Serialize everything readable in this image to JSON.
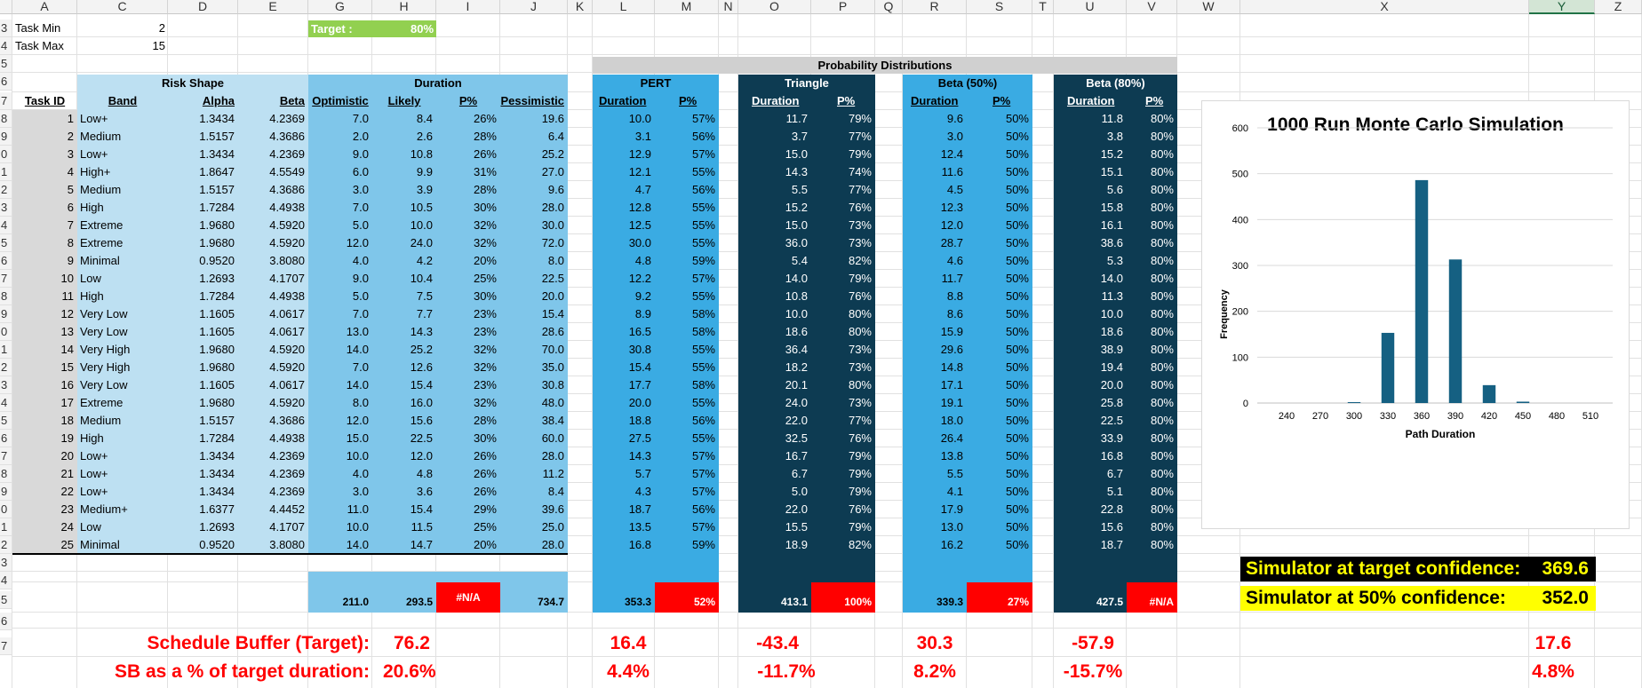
{
  "columns": [
    "A",
    "C",
    "D",
    "E",
    "G",
    "H",
    "I",
    "J",
    "K",
    "L",
    "M",
    "N",
    "O",
    "P",
    "Q",
    "R",
    "S",
    "T",
    "U",
    "V",
    "W",
    "X",
    "Y",
    "Z"
  ],
  "row_numbers": [
    "3",
    "4",
    "5",
    "6",
    "7",
    "8",
    "9",
    "0",
    "1",
    "2",
    "3",
    "4",
    "5",
    "6",
    "7",
    "8",
    "9",
    "0",
    "1",
    "2",
    "3",
    "4",
    "5",
    "6",
    "7",
    "8",
    "9",
    "0",
    "1",
    "2",
    "3",
    "4",
    "5",
    "6",
    "7"
  ],
  "params": {
    "task_min_label": "Task Min",
    "task_min": "2",
    "task_max_label": "Task Max",
    "task_max": "15",
    "target_label": "Target :",
    "target_value": "80%"
  },
  "headers": {
    "prob_dist": "Probability Distributions",
    "risk_shape": "Risk Shape",
    "duration": "Duration",
    "pert": "PERT",
    "triangle": "Triangle",
    "beta50": "Beta (50%)",
    "beta80": "Beta (80%)",
    "task_id": "Task ID",
    "band": "Band",
    "alpha": "Alpha",
    "beta": "Beta",
    "optimistic": "Optimistic",
    "likely": "Likely",
    "ppct": "P%",
    "pessimistic": "Pessimistic",
    "dur": "Duration"
  },
  "rows": [
    [
      "1",
      "Low+",
      "1.3434",
      "4.2369",
      "7.0",
      "8.4",
      "26%",
      "19.6",
      "10.0",
      "57%",
      "11.7",
      "79%",
      "9.6",
      "50%",
      "11.8",
      "80%"
    ],
    [
      "2",
      "Medium",
      "1.5157",
      "4.3686",
      "2.0",
      "2.6",
      "28%",
      "6.4",
      "3.1",
      "56%",
      "3.7",
      "77%",
      "3.0",
      "50%",
      "3.8",
      "80%"
    ],
    [
      "3",
      "Low+",
      "1.3434",
      "4.2369",
      "9.0",
      "10.8",
      "26%",
      "25.2",
      "12.9",
      "57%",
      "15.0",
      "79%",
      "12.4",
      "50%",
      "15.2",
      "80%"
    ],
    [
      "4",
      "High+",
      "1.8647",
      "4.5549",
      "6.0",
      "9.9",
      "31%",
      "27.0",
      "12.1",
      "55%",
      "14.3",
      "74%",
      "11.6",
      "50%",
      "15.1",
      "80%"
    ],
    [
      "5",
      "Medium",
      "1.5157",
      "4.3686",
      "3.0",
      "3.9",
      "28%",
      "9.6",
      "4.7",
      "56%",
      "5.5",
      "77%",
      "4.5",
      "50%",
      "5.6",
      "80%"
    ],
    [
      "6",
      "High",
      "1.7284",
      "4.4938",
      "7.0",
      "10.5",
      "30%",
      "28.0",
      "12.8",
      "55%",
      "15.2",
      "76%",
      "12.3",
      "50%",
      "15.8",
      "80%"
    ],
    [
      "7",
      "Extreme",
      "1.9680",
      "4.5920",
      "5.0",
      "10.0",
      "32%",
      "30.0",
      "12.5",
      "55%",
      "15.0",
      "73%",
      "12.0",
      "50%",
      "16.1",
      "80%"
    ],
    [
      "8",
      "Extreme",
      "1.9680",
      "4.5920",
      "12.0",
      "24.0",
      "32%",
      "72.0",
      "30.0",
      "55%",
      "36.0",
      "73%",
      "28.7",
      "50%",
      "38.6",
      "80%"
    ],
    [
      "9",
      "Minimal",
      "0.9520",
      "3.8080",
      "4.0",
      "4.2",
      "20%",
      "8.0",
      "4.8",
      "59%",
      "5.4",
      "82%",
      "4.6",
      "50%",
      "5.3",
      "80%"
    ],
    [
      "10",
      "Low",
      "1.2693",
      "4.1707",
      "9.0",
      "10.4",
      "25%",
      "22.5",
      "12.2",
      "57%",
      "14.0",
      "79%",
      "11.7",
      "50%",
      "14.0",
      "80%"
    ],
    [
      "11",
      "High",
      "1.7284",
      "4.4938",
      "5.0",
      "7.5",
      "30%",
      "20.0",
      "9.2",
      "55%",
      "10.8",
      "76%",
      "8.8",
      "50%",
      "11.3",
      "80%"
    ],
    [
      "12",
      "Very Low",
      "1.1605",
      "4.0617",
      "7.0",
      "7.7",
      "23%",
      "15.4",
      "8.9",
      "58%",
      "10.0",
      "80%",
      "8.6",
      "50%",
      "10.0",
      "80%"
    ],
    [
      "13",
      "Very Low",
      "1.1605",
      "4.0617",
      "13.0",
      "14.3",
      "23%",
      "28.6",
      "16.5",
      "58%",
      "18.6",
      "80%",
      "15.9",
      "50%",
      "18.6",
      "80%"
    ],
    [
      "14",
      "Very High",
      "1.9680",
      "4.5920",
      "14.0",
      "25.2",
      "32%",
      "70.0",
      "30.8",
      "55%",
      "36.4",
      "73%",
      "29.6",
      "50%",
      "38.9",
      "80%"
    ],
    [
      "15",
      "Very High",
      "1.9680",
      "4.5920",
      "7.0",
      "12.6",
      "32%",
      "35.0",
      "15.4",
      "55%",
      "18.2",
      "73%",
      "14.8",
      "50%",
      "19.4",
      "80%"
    ],
    [
      "16",
      "Very Low",
      "1.1605",
      "4.0617",
      "14.0",
      "15.4",
      "23%",
      "30.8",
      "17.7",
      "58%",
      "20.1",
      "80%",
      "17.1",
      "50%",
      "20.0",
      "80%"
    ],
    [
      "17",
      "Extreme",
      "1.9680",
      "4.5920",
      "8.0",
      "16.0",
      "32%",
      "48.0",
      "20.0",
      "55%",
      "24.0",
      "73%",
      "19.1",
      "50%",
      "25.8",
      "80%"
    ],
    [
      "18",
      "Medium",
      "1.5157",
      "4.3686",
      "12.0",
      "15.6",
      "28%",
      "38.4",
      "18.8",
      "56%",
      "22.0",
      "77%",
      "18.0",
      "50%",
      "22.5",
      "80%"
    ],
    [
      "19",
      "High",
      "1.7284",
      "4.4938",
      "15.0",
      "22.5",
      "30%",
      "60.0",
      "27.5",
      "55%",
      "32.5",
      "76%",
      "26.4",
      "50%",
      "33.9",
      "80%"
    ],
    [
      "20",
      "Low+",
      "1.3434",
      "4.2369",
      "10.0",
      "12.0",
      "26%",
      "28.0",
      "14.3",
      "57%",
      "16.7",
      "79%",
      "13.8",
      "50%",
      "16.8",
      "80%"
    ],
    [
      "21",
      "Low+",
      "1.3434",
      "4.2369",
      "4.0",
      "4.8",
      "26%",
      "11.2",
      "5.7",
      "57%",
      "6.7",
      "79%",
      "5.5",
      "50%",
      "6.7",
      "80%"
    ],
    [
      "22",
      "Low+",
      "1.3434",
      "4.2369",
      "3.0",
      "3.6",
      "26%",
      "8.4",
      "4.3",
      "57%",
      "5.0",
      "79%",
      "4.1",
      "50%",
      "5.1",
      "80%"
    ],
    [
      "23",
      "Medium+",
      "1.6377",
      "4.4452",
      "11.0",
      "15.4",
      "29%",
      "39.6",
      "18.7",
      "56%",
      "22.0",
      "76%",
      "17.9",
      "50%",
      "22.8",
      "80%"
    ],
    [
      "24",
      "Low",
      "1.2693",
      "4.1707",
      "10.0",
      "11.5",
      "25%",
      "25.0",
      "13.5",
      "57%",
      "15.5",
      "79%",
      "13.0",
      "50%",
      "15.6",
      "80%"
    ],
    [
      "25",
      "Minimal",
      "0.9520",
      "3.8080",
      "14.0",
      "14.7",
      "20%",
      "28.0",
      "16.8",
      "59%",
      "18.9",
      "82%",
      "16.2",
      "50%",
      "18.7",
      "80%"
    ]
  ],
  "totals": {
    "opt": "211.0",
    "likely": "293.5",
    "ppct": "#N/A",
    "pess": "734.7",
    "pert": "353.3",
    "pert_p": "52%",
    "tri": "413.1",
    "tri_p": "100%",
    "b50": "339.3",
    "b50_p": "27%",
    "b80": "427.5",
    "b80_p": "#N/A"
  },
  "buffer": {
    "label1": "Schedule Buffer (Target):",
    "label2": "SB as a % of target duration:",
    "h1": "76.2",
    "h2": "20.6%",
    "l1": "16.4",
    "l2": "4.4%",
    "o1": "-43.4",
    "o2": "-11.7%",
    "r1": "30.3",
    "r2": "8.2%",
    "u1": "-57.9",
    "u2": "-15.7%",
    "y1": "17.6",
    "y2": "4.8%"
  },
  "sim": {
    "target_label": "Simulator at target confidence:",
    "target_value": "369.6",
    "half_label": "Simulator at 50% confidence:",
    "half_value": "352.0"
  },
  "colors": {
    "light": "#bde0f2",
    "mid": "#7fc6ea",
    "pert": "#3aabe3",
    "dark": "#0d3b52",
    "red": "#ff0000",
    "green": "#92d050",
    "grey": "#d0d0d0",
    "bar": "#156082"
  },
  "chart_data": {
    "type": "bar",
    "title": "1000 Run Monte Carlo Simulation",
    "xlabel": "Path Duration",
    "ylabel": "Frequency",
    "categories": [
      "240",
      "270",
      "300",
      "330",
      "360",
      "390",
      "420",
      "450",
      "480",
      "510"
    ],
    "values": [
      0,
      0,
      2,
      153,
      486,
      313,
      39,
      3,
      0,
      0
    ],
    "ylim": [
      0,
      600
    ],
    "yticks": [
      "0",
      "100",
      "200",
      "300",
      "400",
      "500",
      "600"
    ],
    "grid": true,
    "legend": "none"
  }
}
